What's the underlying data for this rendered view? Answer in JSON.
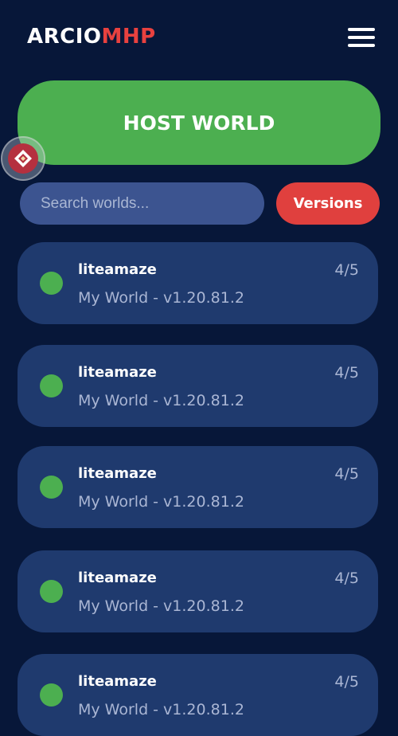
{
  "header": {
    "logo_part_a": "ARCIO",
    "logo_part_b": "MHP",
    "menu_icon": "hamburger-menu-icon"
  },
  "host_button": {
    "label": "HOST WORLD"
  },
  "floating_button": {
    "icon": "diamond-pointer-icon"
  },
  "search": {
    "placeholder": "Search worlds...",
    "value": ""
  },
  "versions_button": {
    "label": "Versions"
  },
  "worlds": [
    {
      "host": "liteamaze",
      "info": "My World - v1.20.81.2",
      "players": "4/5",
      "status": "online"
    },
    {
      "host": "liteamaze",
      "info": "My World - v1.20.81.2",
      "players": "4/5",
      "status": "online"
    },
    {
      "host": "liteamaze",
      "info": "My World - v1.20.81.2",
      "players": "4/5",
      "status": "online"
    },
    {
      "host": "liteamaze",
      "info": "My World - v1.20.81.2",
      "players": "4/5",
      "status": "online"
    },
    {
      "host": "liteamaze",
      "info": "My World - v1.20.81.2",
      "players": "4/5",
      "status": "online"
    }
  ],
  "colors": {
    "background": "#071739",
    "card": "#1f3a6e",
    "accent_green": "#4caf50",
    "accent_red": "#e0403e",
    "search_bg": "#3c5490"
  }
}
